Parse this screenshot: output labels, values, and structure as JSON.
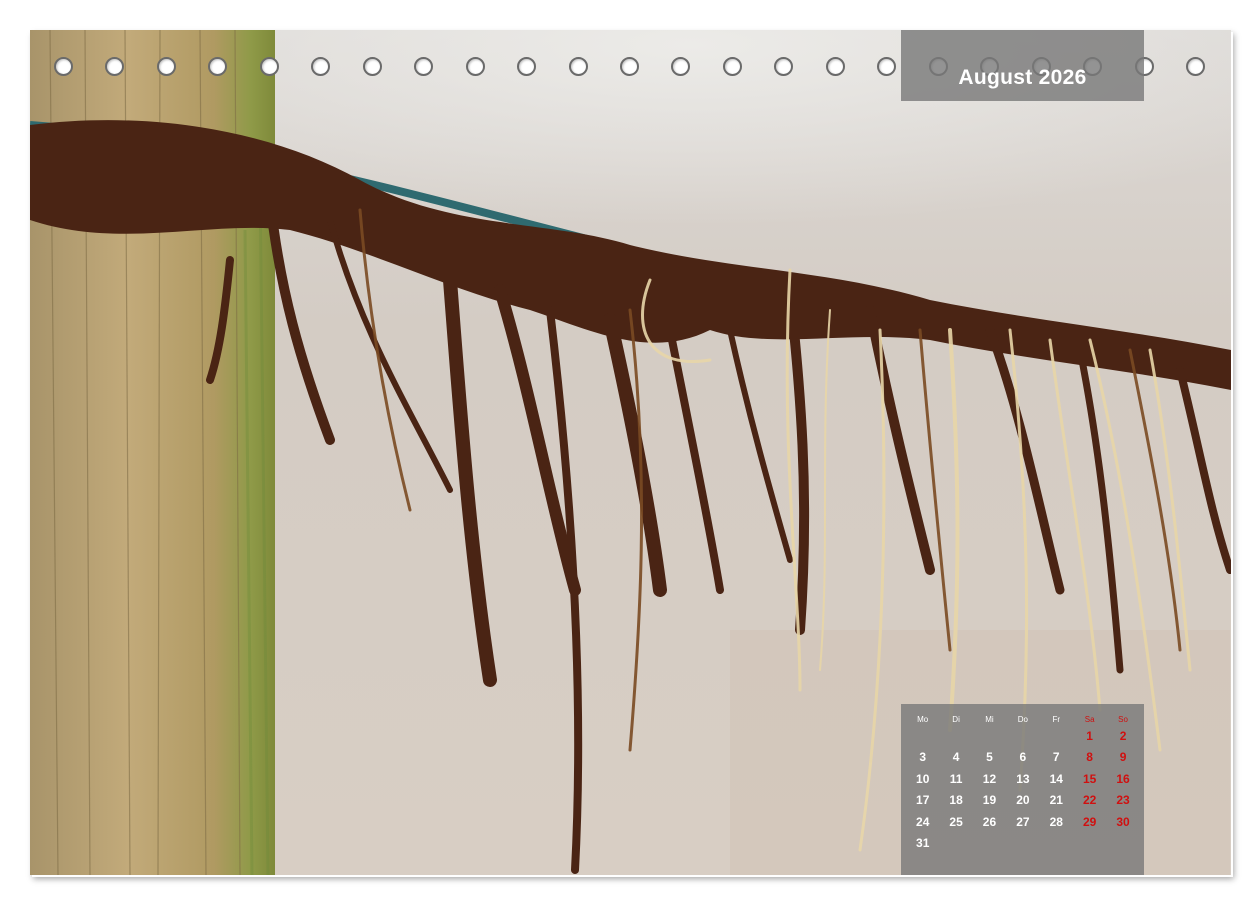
{
  "calendar": {
    "month_title": "August 2026",
    "weekday_headers": [
      "Mo",
      "Di",
      "Mi",
      "Do",
      "Fr",
      "Sa",
      "So"
    ],
    "weeks": [
      [
        "",
        "",
        "",
        "",
        "",
        "1",
        "2"
      ],
      [
        "3",
        "4",
        "5",
        "6",
        "7",
        "8",
        "9"
      ],
      [
        "10",
        "11",
        "12",
        "13",
        "14",
        "15",
        "16"
      ],
      [
        "17",
        "18",
        "19",
        "20",
        "21",
        "22",
        "23"
      ],
      [
        "24",
        "25",
        "26",
        "27",
        "28",
        "29",
        "30"
      ],
      [
        "31",
        "",
        "",
        "",
        "",
        "",
        ""
      ]
    ],
    "weekend_color": "#d01010",
    "text_color": "#ffffff",
    "overlay_color": "#787878"
  },
  "binding": {
    "ring_count": 23
  },
  "photo": {
    "subject_icon": "seaweed-on-fence-wire-photo",
    "colors": {
      "background_sand": "#d6cdc3",
      "post_wood": "#b49a6a",
      "moss": "#8a9a4a",
      "wire": "#2f6a70",
      "seaweed_dark": "#4a2414",
      "seaweed_light": "#e8d6a8"
    }
  }
}
